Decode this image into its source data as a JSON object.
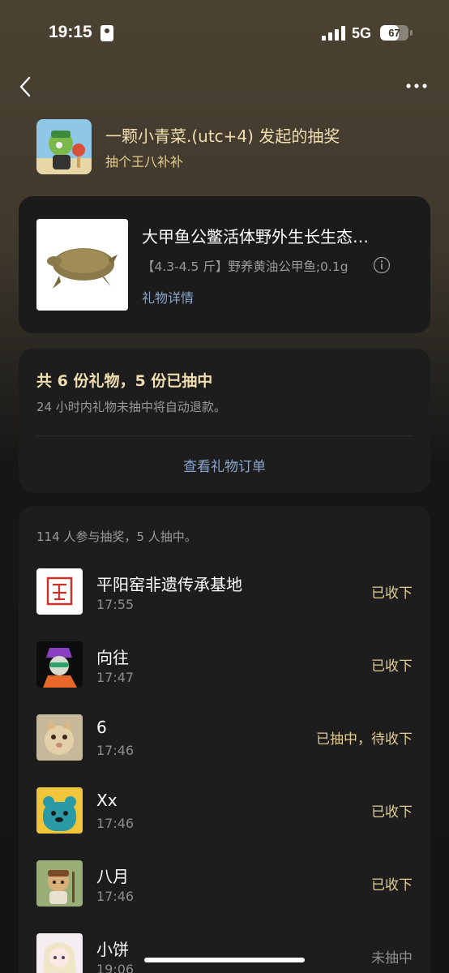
{
  "status_bar": {
    "time": "19:15",
    "network": "5G",
    "battery": "67",
    "battery_level": 0.67
  },
  "header": {
    "title": "一颗小青菜.(utc+4) 发起的抽奖",
    "subtitle": "抽个王八补补"
  },
  "product": {
    "name": "大甲鱼公鳖活体野外生长生态…",
    "spec": "【4.3-4.5 斤】野养黄油公甲鱼;0.1g",
    "detail_link": "礼物详情"
  },
  "summary": {
    "title": "共 6 份礼物，5 份已抽中",
    "note": "24 小时内礼物未抽中将自动退款。",
    "orders_link": "查看礼物订单"
  },
  "winners": {
    "summary": "114 人参与抽奖，5 人抽中。",
    "rows": [
      {
        "name": "平阳窑非遗传承基地",
        "time": "17:55",
        "status": "已收下"
      },
      {
        "name": "向往",
        "time": "17:47",
        "status": "已收下"
      },
      {
        "name": "6",
        "time": "17:46",
        "status": "已抽中，待收下"
      },
      {
        "name": "Xx",
        "time": "17:46",
        "status": "已收下"
      },
      {
        "name": "八月",
        "time": "17:46",
        "status": "已收下"
      },
      {
        "name": "小饼",
        "time": "19:06",
        "status": "未抽中"
      }
    ]
  },
  "colors": {
    "accent_gold": "#f0deb0",
    "link_blue": "#8aa6cf",
    "card_bg": "#1d1d1d"
  }
}
